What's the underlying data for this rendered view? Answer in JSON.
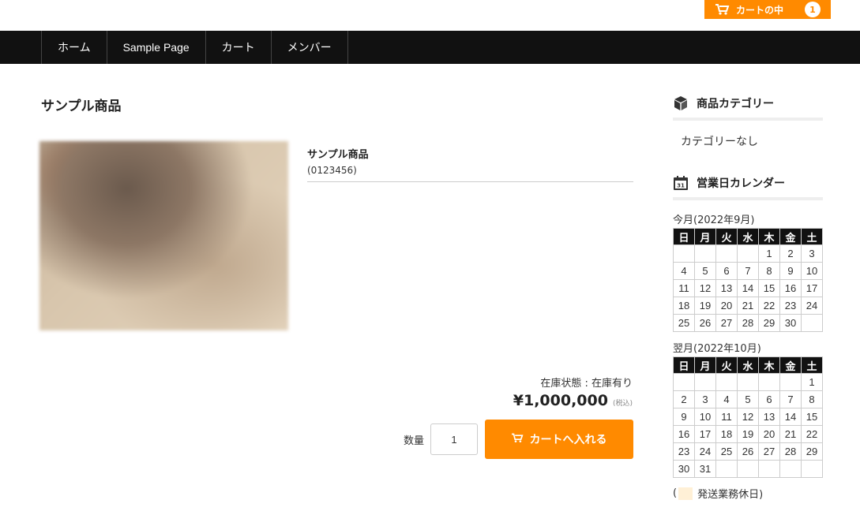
{
  "header": {
    "cart_button_label": "カートの中",
    "cart_count": "1",
    "accent_color": "#ff8a00"
  },
  "nav": {
    "items": [
      "ホーム",
      "Sample Page",
      "カート",
      "メンバー"
    ]
  },
  "product": {
    "page_title": "サンプル商品",
    "name": "サンプル商品",
    "code": "(0123456)",
    "stock_status": "在庫状態 : 在庫有り",
    "price": "¥1,000,000",
    "tax_note": "(税込)",
    "quantity_label": "数量",
    "quantity_value": "1",
    "add_to_cart_label": "カートへ入れる"
  },
  "sidebar": {
    "category_title": "商品カテゴリー",
    "category_empty_text": "カテゴリーなし",
    "calendar_title": "営業日カレンダー",
    "weekdays": [
      "日",
      "月",
      "火",
      "水",
      "木",
      "金",
      "土"
    ],
    "calendars": [
      {
        "caption": "今月(2022年9月)",
        "weeks": [
          [
            "",
            "",
            "",
            "",
            "1",
            "2",
            "3"
          ],
          [
            "4",
            "5",
            "6",
            "7",
            "8",
            "9",
            "10"
          ],
          [
            "11",
            "12",
            "13",
            "14",
            "15",
            "16",
            "17"
          ],
          [
            "18",
            "19",
            "20",
            "21",
            "22",
            "23",
            "24"
          ],
          [
            "25",
            "26",
            "27",
            "28",
            "29",
            "30",
            ""
          ]
        ]
      },
      {
        "caption": "翌月(2022年10月)",
        "weeks": [
          [
            "",
            "",
            "",
            "",
            "",
            "",
            "1"
          ],
          [
            "2",
            "3",
            "4",
            "5",
            "6",
            "7",
            "8"
          ],
          [
            "9",
            "10",
            "11",
            "12",
            "13",
            "14",
            "15"
          ],
          [
            "16",
            "17",
            "18",
            "19",
            "20",
            "21",
            "22"
          ],
          [
            "23",
            "24",
            "25",
            "26",
            "27",
            "28",
            "29"
          ],
          [
            "30",
            "31",
            "",
            "",
            "",
            "",
            ""
          ]
        ]
      }
    ],
    "legend_open": "(",
    "legend_label": "発送業務休日)",
    "holiday_color": "#fff0d6"
  }
}
